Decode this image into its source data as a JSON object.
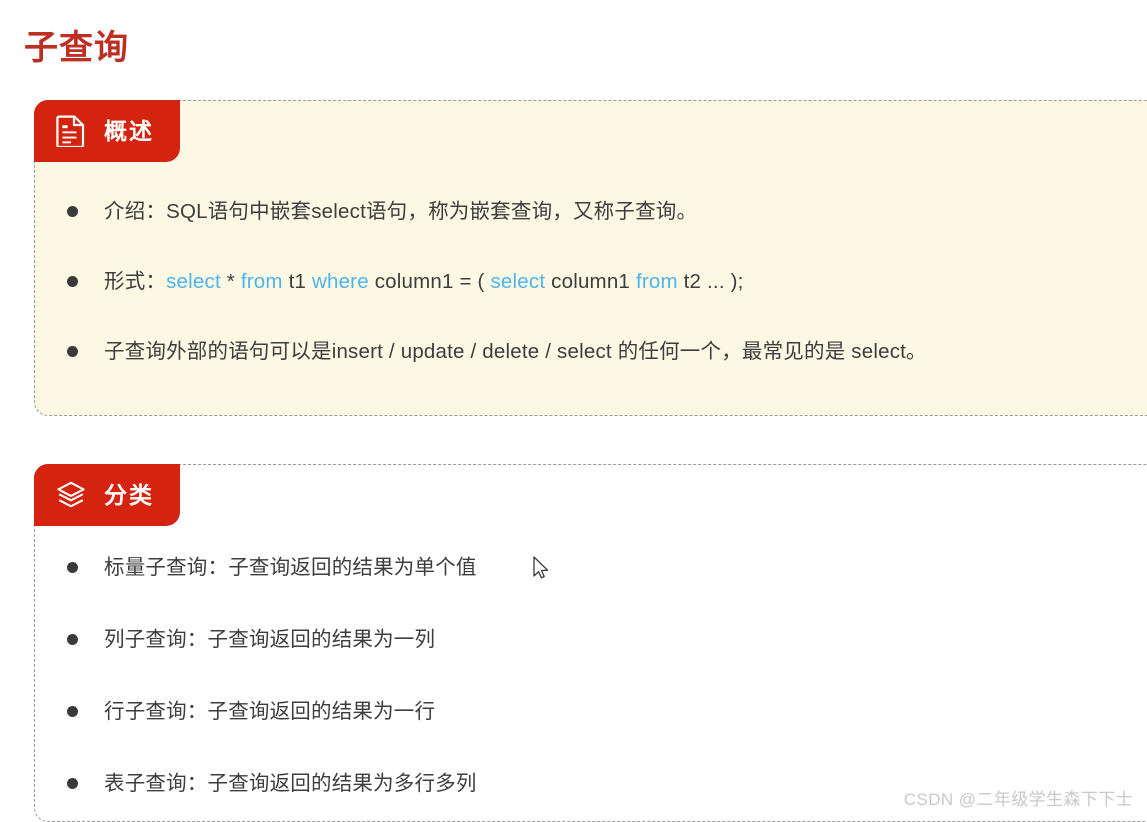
{
  "page": {
    "title": "子查询",
    "title_color": "#bd2f23",
    "accent_color": "#d4230f",
    "keyword_color": "#4db4ef",
    "cream_bg": "#fdf8e3",
    "watermark": "CSDN @二年级学生森下下士"
  },
  "sections": [
    {
      "header": {
        "icon": "document-icon",
        "label": "概述"
      },
      "items": [
        {
          "id": "intro",
          "parts": [
            {
              "type": "text",
              "value": "介绍：SQL语句中嵌套select语句，称为嵌套查询，又称子查询。"
            }
          ],
          "plain": "介绍：SQL语句中嵌套select语句，称为嵌套查询，又称子查询。"
        },
        {
          "id": "syntax",
          "parts": [
            {
              "type": "text",
              "value": "形式："
            },
            {
              "type": "keyword",
              "value": "select"
            },
            {
              "type": "text",
              "value": " * "
            },
            {
              "type": "keyword",
              "value": "from"
            },
            {
              "type": "text",
              "value": "  t1  "
            },
            {
              "type": "keyword",
              "value": "where"
            },
            {
              "type": "text",
              "value": " column1 = ( "
            },
            {
              "type": "keyword",
              "value": "select"
            },
            {
              "type": "text",
              "value": " column1 "
            },
            {
              "type": "keyword",
              "value": "from"
            },
            {
              "type": "text",
              "value": "  t2 ... );"
            }
          ],
          "plain": "形式：select * from  t1  where column1 = ( select column1 from  t2 ... );"
        },
        {
          "id": "outer-statement",
          "parts": [
            {
              "type": "text",
              "value": "子查询外部的语句可以是insert / update / delete / select 的任何一个，最常见的是 select。"
            }
          ],
          "plain": "子查询外部的语句可以是insert / update / delete / select 的任何一个，最常见的是 select。"
        }
      ]
    },
    {
      "header": {
        "icon": "layers-icon",
        "label": "分类"
      },
      "items": [
        {
          "id": "scalar-subquery",
          "plain": "标量子查询：子查询返回的结果为单个值"
        },
        {
          "id": "column-subquery",
          "plain": "列子查询：子查询返回的结果为一列"
        },
        {
          "id": "row-subquery",
          "plain": "行子查询：子查询返回的结果为一行"
        },
        {
          "id": "table-subquery",
          "plain": "表子查询：子查询返回的结果为多行多列"
        }
      ]
    }
  ]
}
